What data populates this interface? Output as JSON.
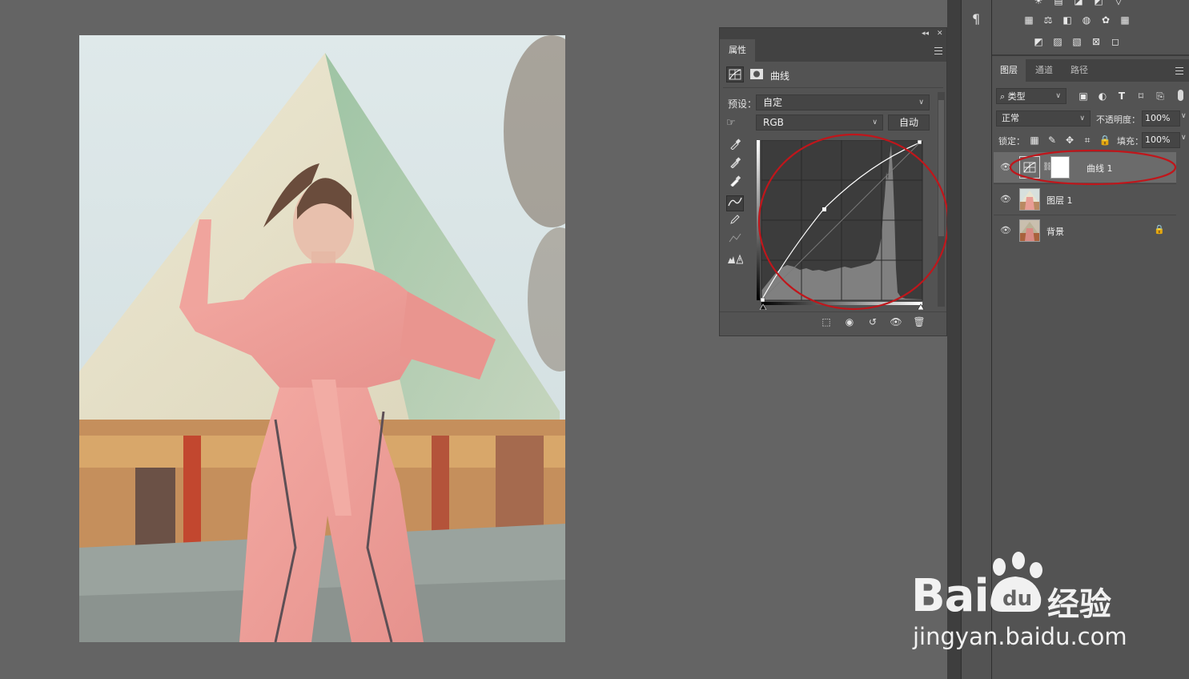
{
  "properties_panel": {
    "tab_label": "属性",
    "adjustment_name": "曲线",
    "preset_label": "预设：",
    "preset_value": "自定",
    "channel_value": "RGB",
    "auto_button": "自动"
  },
  "layers_panel": {
    "tabs": [
      "图层",
      "通道",
      "路径"
    ],
    "filter_value": "类型",
    "blend_mode": "正常",
    "opacity_label": "不透明度：",
    "opacity_value": "100%",
    "lock_label": "锁定：",
    "fill_label": "填充：",
    "fill_value": "100%",
    "layers": [
      {
        "name": "曲线 1",
        "selected": true,
        "type": "adjustment"
      },
      {
        "name": "图层 1",
        "selected": false,
        "type": "pixel"
      },
      {
        "name": "背景",
        "selected": false,
        "type": "background",
        "locked": true
      }
    ]
  },
  "watermark": {
    "brand": "Bai",
    "brand_suffix": "经验",
    "url": "jingyan.baidu.com"
  },
  "colors": {
    "app_bg": "#646464",
    "panel_bg": "#535353",
    "annotation_red": "#c0161b"
  }
}
